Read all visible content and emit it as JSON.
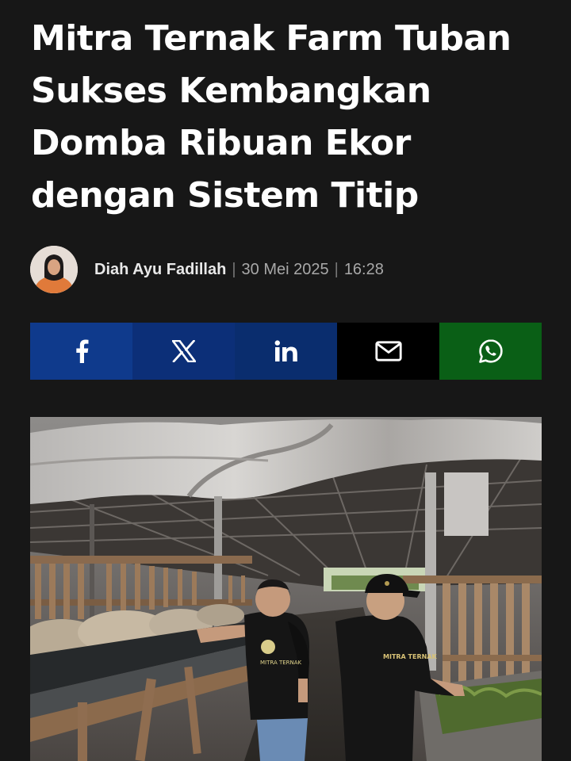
{
  "article": {
    "headline": "Mitra Ternak Farm Tuban Sukses Kembangkan Domba Ribuan Ekor dengan Sistem Titip",
    "author": "Diah Ayu Fadillah",
    "date": "30 Mei 2025",
    "time": "16:28",
    "separator": "|"
  },
  "share": {
    "buttons": [
      {
        "name": "facebook",
        "icon": "facebook-icon",
        "color": "#0f3a8c"
      },
      {
        "name": "x",
        "icon": "x-icon",
        "color": "#0c2f78"
      },
      {
        "name": "linkedin",
        "icon": "linkedin-icon",
        "color": "#0a2d6e"
      },
      {
        "name": "email",
        "icon": "mail-icon",
        "color": "#000000"
      },
      {
        "name": "whatsapp",
        "icon": "whatsapp-icon",
        "color": "#0a5f16"
      }
    ]
  },
  "photo": {
    "shirt_text_1": "MITRA TERNAK",
    "shirt_text_2": "MITRA TERNAK"
  }
}
